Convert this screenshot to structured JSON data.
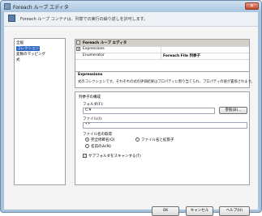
{
  "window": {
    "title": "Foreach ループ エディタ",
    "close_glyph": "✕"
  },
  "header": {
    "text": "Foreach ループ コンテナは、列挙での実行の繰り返しを許可します。"
  },
  "nav": {
    "items": [
      {
        "label": "全般"
      },
      {
        "label": "コレクション"
      },
      {
        "label": "変数のマッピング"
      },
      {
        "label": "式"
      }
    ],
    "selected_index": 1
  },
  "grid": {
    "category": "Foreach ループ エディタ",
    "expressions_label": "Expressions",
    "enumerator_key": "Enumerator",
    "enumerator_value": "Foreach File 列挙子",
    "expand_glyph": "-",
    "collapse_glyph": "+"
  },
  "description": {
    "title": "Expressions",
    "text": "式のコレクションです。それぞれの式の評価結果はプロパティに割り当てられ、プロパティの値が置換されます。"
  },
  "config": {
    "section_title": "列挙子の構成",
    "folder_label": "フォルダ(F):",
    "folder_value": "C:¥",
    "browse_button": "参照(B)...",
    "files_label": "ファイル(I):",
    "files_value": "*.*",
    "retrieve_label": "ファイル名の取得",
    "option_full": "完全修飾名(Q)",
    "option_name_ext": "ファイル名と拡張子",
    "option_name_only": "名前のみ(N)",
    "selected_option": "完全修飾名(Q)",
    "subfolder_label": "サブフォルダをスキャンする(T)",
    "subfolder_checked": true,
    "check_glyph": "✓"
  },
  "footer": {
    "ok": "OK",
    "cancel": "キャンセル",
    "help": "ヘルプ(H)"
  },
  "colors": {
    "selection": "#316ac5",
    "frame": "#aac3dc",
    "close": "#c8472b"
  }
}
